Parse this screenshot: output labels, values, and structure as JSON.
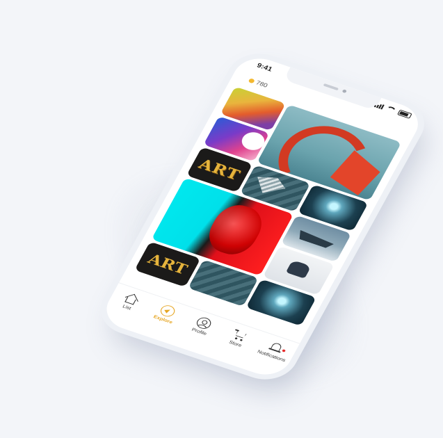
{
  "status_bar": {
    "time": "9:41"
  },
  "header": {
    "coins": "780"
  },
  "gallery": {
    "art_label": "ART",
    "art_label_2": "ART"
  },
  "tabbar": {
    "items": [
      {
        "label": "List",
        "icon": "home-icon"
      },
      {
        "label": "Explore",
        "icon": "compass-icon",
        "active": true
      },
      {
        "label": "Profile",
        "icon": "profile-icon"
      },
      {
        "label": "Store",
        "icon": "cart-icon"
      },
      {
        "label": "Notifications",
        "icon": "bell-icon"
      }
    ]
  },
  "colors": {
    "accent": "#e6a623",
    "notification_dot": "#e52b2b",
    "background": "#f3f5f9"
  }
}
